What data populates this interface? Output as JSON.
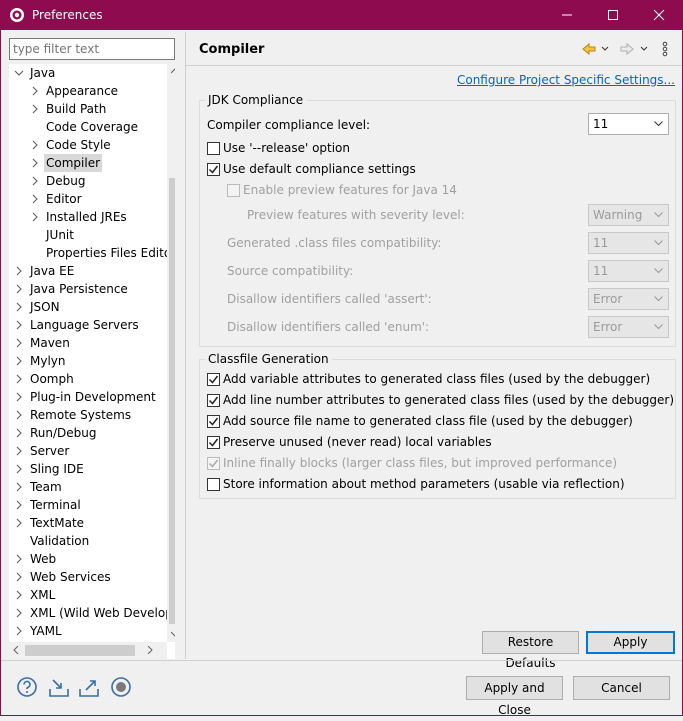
{
  "window": {
    "title": "Preferences"
  },
  "filter": {
    "placeholder": "type filter text"
  },
  "tree": [
    {
      "label": "Java",
      "depth": 0,
      "state": "expanded"
    },
    {
      "label": "Appearance",
      "depth": 1,
      "state": "collapsed"
    },
    {
      "label": "Build Path",
      "depth": 1,
      "state": "collapsed"
    },
    {
      "label": "Code Coverage",
      "depth": 1,
      "state": "leaf"
    },
    {
      "label": "Code Style",
      "depth": 1,
      "state": "collapsed"
    },
    {
      "label": "Compiler",
      "depth": 1,
      "state": "collapsed",
      "selected": true
    },
    {
      "label": "Debug",
      "depth": 1,
      "state": "collapsed"
    },
    {
      "label": "Editor",
      "depth": 1,
      "state": "collapsed"
    },
    {
      "label": "Installed JREs",
      "depth": 1,
      "state": "collapsed"
    },
    {
      "label": "JUnit",
      "depth": 1,
      "state": "leaf"
    },
    {
      "label": "Properties Files Editor",
      "depth": 1,
      "state": "leaf"
    },
    {
      "label": "Java EE",
      "depth": 0,
      "state": "collapsed"
    },
    {
      "label": "Java Persistence",
      "depth": 0,
      "state": "collapsed"
    },
    {
      "label": "JSON",
      "depth": 0,
      "state": "collapsed"
    },
    {
      "label": "Language Servers",
      "depth": 0,
      "state": "collapsed"
    },
    {
      "label": "Maven",
      "depth": 0,
      "state": "collapsed"
    },
    {
      "label": "Mylyn",
      "depth": 0,
      "state": "collapsed"
    },
    {
      "label": "Oomph",
      "depth": 0,
      "state": "collapsed"
    },
    {
      "label": "Plug-in Development",
      "depth": 0,
      "state": "collapsed"
    },
    {
      "label": "Remote Systems",
      "depth": 0,
      "state": "collapsed"
    },
    {
      "label": "Run/Debug",
      "depth": 0,
      "state": "collapsed"
    },
    {
      "label": "Server",
      "depth": 0,
      "state": "collapsed"
    },
    {
      "label": "Sling IDE",
      "depth": 0,
      "state": "collapsed"
    },
    {
      "label": "Team",
      "depth": 0,
      "state": "collapsed"
    },
    {
      "label": "Terminal",
      "depth": 0,
      "state": "collapsed"
    },
    {
      "label": "TextMate",
      "depth": 0,
      "state": "collapsed"
    },
    {
      "label": "Validation",
      "depth": 0,
      "state": "leaf"
    },
    {
      "label": "Web",
      "depth": 0,
      "state": "collapsed"
    },
    {
      "label": "Web Services",
      "depth": 0,
      "state": "collapsed"
    },
    {
      "label": "XML",
      "depth": 0,
      "state": "collapsed"
    },
    {
      "label": "XML (Wild Web Developer)",
      "depth": 0,
      "state": "collapsed"
    },
    {
      "label": "YAML",
      "depth": 0,
      "state": "collapsed"
    }
  ],
  "page": {
    "title": "Compiler",
    "configure_link": "Configure Project Specific Settings..."
  },
  "jdk": {
    "group_label": "JDK Compliance",
    "compliance_label": "Compiler compliance level:",
    "compliance_value": "11",
    "release_label": "Use '--release' option",
    "release_checked": false,
    "use_default_label": "Use default compliance settings",
    "use_default_checked": true,
    "preview_label": "Enable preview features for Java 14",
    "preview_checked": false,
    "severity_label": "Preview features with severity level:",
    "severity_value": "Warning",
    "generated_label": "Generated .class files compatibility:",
    "generated_value": "11",
    "source_label": "Source compatibility:",
    "source_value": "11",
    "assert_label": "Disallow identifiers called 'assert':",
    "assert_value": "Error",
    "enum_label": "Disallow identifiers called 'enum':",
    "enum_value": "Error"
  },
  "classfile": {
    "group_label": "Classfile Generation",
    "items": [
      {
        "label": "Add variable attributes to generated class files (used by the debugger)",
        "checked": true,
        "enabled": true
      },
      {
        "label": "Add line number attributes to generated class files (used by the debugger)",
        "checked": true,
        "enabled": true
      },
      {
        "label": "Add source file name to generated class file (used by the debugger)",
        "checked": true,
        "enabled": true
      },
      {
        "label": "Preserve unused (never read) local variables",
        "checked": true,
        "enabled": true
      },
      {
        "label": "Inline finally blocks (larger class files, but improved performance)",
        "checked": true,
        "enabled": false
      },
      {
        "label": "Store information about method parameters (usable via reflection)",
        "checked": false,
        "enabled": true
      }
    ]
  },
  "buttons": {
    "restore_defaults": "Restore Defaults",
    "apply": "Apply",
    "apply_and_close": "Apply and Close",
    "cancel": "Cancel"
  },
  "colors": {
    "titlebar": "#8e0b4f",
    "link": "#0066cc",
    "accent": "#0078d7"
  },
  "icons": [
    "help-icon",
    "import-icon",
    "export-icon",
    "record-icon",
    "back-arrow-icon",
    "forward-arrow-icon",
    "view-menu-icon"
  ]
}
